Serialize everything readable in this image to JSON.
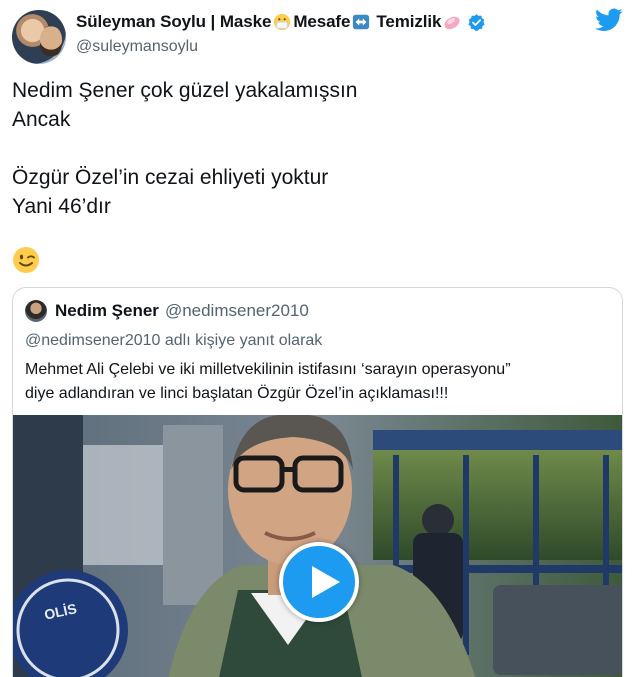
{
  "author": {
    "name_part1": "Süleyman Soylu | Maske",
    "name_part2": "Mesafe",
    "name_part3": "Temizlik",
    "handle": "@suleymansoylu",
    "name_emojis": [
      "mask-emoji",
      "left-right-arrow-emoji",
      "soap-emoji"
    ]
  },
  "tweet": {
    "lines": [
      "Nedim Şener çok güzel yakalamışsın",
      "Ancak",
      "Özgür Özel’in cezai ehliyeti yoktur",
      "Yani 46’dır"
    ],
    "emoji": "winking-face-emoji"
  },
  "quoted_tweet": {
    "name": "Nedim Şener",
    "handle": "@nedimsener2010",
    "reply_context": "@nedimsener2010 adlı kişiye yanıt olarak",
    "text_line1": "Mehmet Ali Çelebi ve iki milletvekilinin istifasını ‘sarayın operasyonu”",
    "text_line2": "diye adlandıran ve linci başlatan Özgür Özel’in açıklaması!!!",
    "video_overlay_text": "OLİS"
  },
  "colors": {
    "twitter_blue": "#1d9bf0",
    "secondary_text": "#536471",
    "border": "#cfd9de"
  },
  "icons": [
    "twitter-bird-icon",
    "verified-badge-icon",
    "play-icon"
  ]
}
